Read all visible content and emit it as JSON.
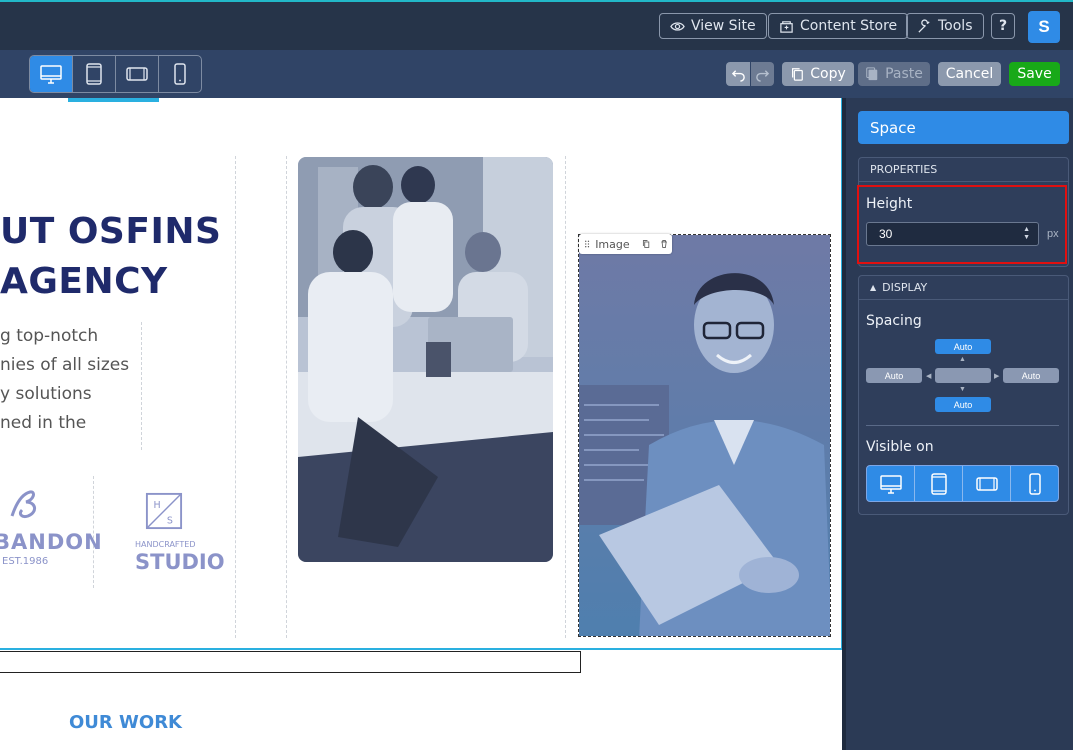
{
  "topbar": {
    "view_site": "View Site",
    "content_store": "Content Store",
    "tools": "Tools",
    "help": "?",
    "avatar": "S"
  },
  "toolbar": {
    "copy": "Copy",
    "paste": "Paste",
    "cancel": "Cancel",
    "save": "Save"
  },
  "canvas": {
    "heading_line1": "UT OSFINS",
    "heading_line2": "AGENCY",
    "para_lines": [
      "g top-notch",
      "nies of all sizes",
      "y solutions",
      "ned in the"
    ],
    "logo1_text": "BANDON",
    "logo1_sub": "EST.1986",
    "logo2_top": "H S",
    "logo2_text1": "HANDCRAFTED",
    "logo2_text2": "STUDIO",
    "image_badge": "Image",
    "our_work": "OUR WORK"
  },
  "panel": {
    "title": "Space",
    "properties_header": "PROPERTIES",
    "height_label": "Height",
    "height_value": "30",
    "height_unit": "px",
    "display_header": "DISPLAY",
    "spacing_label": "Spacing",
    "spacing_top": "Auto",
    "spacing_left": "Auto",
    "spacing_right": "Auto",
    "spacing_bottom": "Auto",
    "visible_on_label": "Visible on"
  },
  "colors": {
    "accent": "#2f8be6",
    "save": "#18a918",
    "highlight": "#e01010",
    "heading": "#1f2a6b"
  }
}
